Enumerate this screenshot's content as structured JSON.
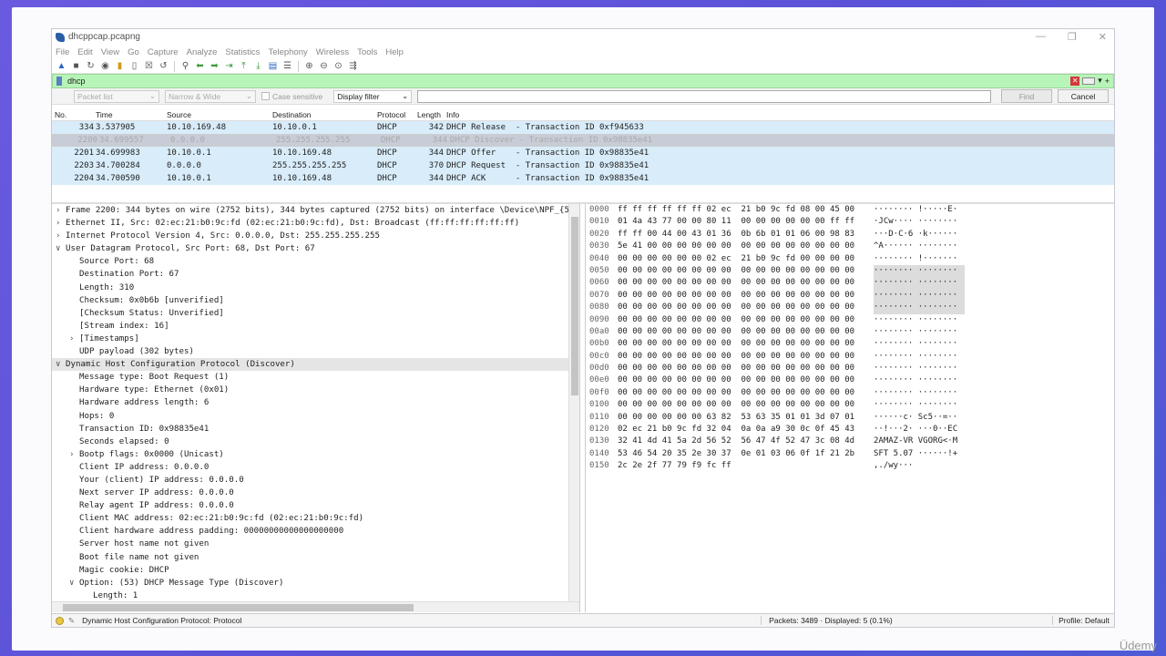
{
  "window": {
    "title": "dhcppcap.pcapng"
  },
  "menu": [
    "File",
    "Edit",
    "View",
    "Go",
    "Capture",
    "Analyze",
    "Statistics",
    "Telephony",
    "Wireless",
    "Tools",
    "Help"
  ],
  "filter": {
    "value": "dhcp"
  },
  "find": {
    "packet_list_select": "Packet list",
    "charset_select": "Narrow & Wide",
    "case_sensitive_label": "Case sensitive",
    "type_select": "Display filter",
    "find_button": "Find",
    "cancel_button": "Cancel"
  },
  "packet_list": {
    "headers": [
      "No.",
      "Time",
      "Source",
      "Destination",
      "Protocol",
      "Length",
      "Info"
    ],
    "rows": [
      {
        "no": "334",
        "time": "3.537905",
        "src": "10.10.169.48",
        "dst": "10.10.0.1",
        "proto": "DHCP",
        "len": "342",
        "info": "DHCP Release  - Transaction ID 0xf945633"
      },
      {
        "no": "2200",
        "time": "34.699557",
        "src": "0.0.0.0",
        "dst": "255.255.255.255",
        "proto": "DHCP",
        "len": "344",
        "info": "DHCP Discover - Transaction ID 0x98835e41"
      },
      {
        "no": "2201",
        "time": "34.699983",
        "src": "10.10.0.1",
        "dst": "10.10.169.48",
        "proto": "DHCP",
        "len": "344",
        "info": "DHCP Offer    - Transaction ID 0x98835e41"
      },
      {
        "no": "2203",
        "time": "34.700284",
        "src": "0.0.0.0",
        "dst": "255.255.255.255",
        "proto": "DHCP",
        "len": "370",
        "info": "DHCP Request  - Transaction ID 0x98835e41"
      },
      {
        "no": "2204",
        "time": "34.700590",
        "src": "10.10.0.1",
        "dst": "10.10.169.48",
        "proto": "DHCP",
        "len": "344",
        "info": "DHCP ACK      - Transaction ID 0x98835e41"
      }
    ]
  },
  "details": [
    {
      "indent": 0,
      "arrow": ">",
      "text": "Frame 2200: 344 bytes on wire (2752 bits), 344 bytes captured (2752 bits) on interface \\Device\\NPF_{5"
    },
    {
      "indent": 0,
      "arrow": ">",
      "text": "Ethernet II, Src: 02:ec:21:b0:9c:fd (02:ec:21:b0:9c:fd), Dst: Broadcast (ff:ff:ff:ff:ff:ff)"
    },
    {
      "indent": 0,
      "arrow": ">",
      "text": "Internet Protocol Version 4, Src: 0.0.0.0, Dst: 255.255.255.255"
    },
    {
      "indent": 0,
      "arrow": "v",
      "text": "User Datagram Protocol, Src Port: 68, Dst Port: 67"
    },
    {
      "indent": 1,
      "arrow": "",
      "text": "Source Port: 68"
    },
    {
      "indent": 1,
      "arrow": "",
      "text": "Destination Port: 67"
    },
    {
      "indent": 1,
      "arrow": "",
      "text": "Length: 310"
    },
    {
      "indent": 1,
      "arrow": "",
      "text": "Checksum: 0x0b6b [unverified]"
    },
    {
      "indent": 1,
      "arrow": "",
      "text": "[Checksum Status: Unverified]"
    },
    {
      "indent": 1,
      "arrow": "",
      "text": "[Stream index: 16]"
    },
    {
      "indent": 1,
      "arrow": ">",
      "text": "[Timestamps]"
    },
    {
      "indent": 1,
      "arrow": "",
      "text": "UDP payload (302 bytes)"
    },
    {
      "indent": 0,
      "arrow": "v",
      "text": "Dynamic Host Configuration Protocol (Discover)",
      "hl": true
    },
    {
      "indent": 1,
      "arrow": "",
      "text": "Message type: Boot Request (1)"
    },
    {
      "indent": 1,
      "arrow": "",
      "text": "Hardware type: Ethernet (0x01)"
    },
    {
      "indent": 1,
      "arrow": "",
      "text": "Hardware address length: 6"
    },
    {
      "indent": 1,
      "arrow": "",
      "text": "Hops: 0"
    },
    {
      "indent": 1,
      "arrow": "",
      "text": "Transaction ID: 0x98835e41"
    },
    {
      "indent": 1,
      "arrow": "",
      "text": "Seconds elapsed: 0"
    },
    {
      "indent": 1,
      "arrow": ">",
      "text": "Bootp flags: 0x0000 (Unicast)"
    },
    {
      "indent": 1,
      "arrow": "",
      "text": "Client IP address: 0.0.0.0"
    },
    {
      "indent": 1,
      "arrow": "",
      "text": "Your (client) IP address: 0.0.0.0"
    },
    {
      "indent": 1,
      "arrow": "",
      "text": "Next server IP address: 0.0.0.0"
    },
    {
      "indent": 1,
      "arrow": "",
      "text": "Relay agent IP address: 0.0.0.0"
    },
    {
      "indent": 1,
      "arrow": "",
      "text": "Client MAC address: 02:ec:21:b0:9c:fd (02:ec:21:b0:9c:fd)"
    },
    {
      "indent": 1,
      "arrow": "",
      "text": "Client hardware address padding: 00000000000000000000"
    },
    {
      "indent": 1,
      "arrow": "",
      "text": "Server host name not given"
    },
    {
      "indent": 1,
      "arrow": "",
      "text": "Boot file name not given"
    },
    {
      "indent": 1,
      "arrow": "",
      "text": "Magic cookie: DHCP"
    },
    {
      "indent": 1,
      "arrow": "v",
      "text": "Option: (53) DHCP Message Type (Discover)"
    },
    {
      "indent": 2,
      "arrow": "",
      "text": "Length: 1"
    }
  ],
  "hex": [
    {
      "off": "0000",
      "bytes": "ff ff ff ff ff ff 02 ec  21 b0 9c fd 08 00 45 00",
      "ascii": "········ !·····E·",
      "g": false
    },
    {
      "off": "0010",
      "bytes": "01 4a 43 77 00 00 80 11  00 00 00 00 00 00 ff ff",
      "ascii": "·JCw···· ········",
      "g": false
    },
    {
      "off": "0020",
      "bytes": "ff ff 00 44 00 43 01 36  0b 6b 01 01 06 00 98 83",
      "ascii": "···D·C·6 ·k······",
      "g": false
    },
    {
      "off": "0030",
      "bytes": "5e 41 00 00 00 00 00 00  00 00 00 00 00 00 00 00",
      "ascii": "^A······ ········",
      "g": false
    },
    {
      "off": "0040",
      "bytes": "00 00 00 00 00 00 02 ec  21 b0 9c fd 00 00 00 00",
      "ascii": "········ !·······",
      "g": false
    },
    {
      "off": "0050",
      "bytes": "00 00 00 00 00 00 00 00  00 00 00 00 00 00 00 00",
      "ascii": "········ ········",
      "g": true
    },
    {
      "off": "0060",
      "bytes": "00 00 00 00 00 00 00 00  00 00 00 00 00 00 00 00",
      "ascii": "········ ········",
      "g": true
    },
    {
      "off": "0070",
      "bytes": "00 00 00 00 00 00 00 00  00 00 00 00 00 00 00 00",
      "ascii": "········ ········",
      "g": true
    },
    {
      "off": "0080",
      "bytes": "00 00 00 00 00 00 00 00  00 00 00 00 00 00 00 00",
      "ascii": "········ ········",
      "g": true
    },
    {
      "off": "0090",
      "bytes": "00 00 00 00 00 00 00 00  00 00 00 00 00 00 00 00",
      "ascii": "········ ········",
      "g": false
    },
    {
      "off": "00a0",
      "bytes": "00 00 00 00 00 00 00 00  00 00 00 00 00 00 00 00",
      "ascii": "········ ········",
      "g": false
    },
    {
      "off": "00b0",
      "bytes": "00 00 00 00 00 00 00 00  00 00 00 00 00 00 00 00",
      "ascii": "········ ········",
      "g": false
    },
    {
      "off": "00c0",
      "bytes": "00 00 00 00 00 00 00 00  00 00 00 00 00 00 00 00",
      "ascii": "········ ········",
      "g": false
    },
    {
      "off": "00d0",
      "bytes": "00 00 00 00 00 00 00 00  00 00 00 00 00 00 00 00",
      "ascii": "········ ········",
      "g": false
    },
    {
      "off": "00e0",
      "bytes": "00 00 00 00 00 00 00 00  00 00 00 00 00 00 00 00",
      "ascii": "········ ········",
      "g": false
    },
    {
      "off": "00f0",
      "bytes": "00 00 00 00 00 00 00 00  00 00 00 00 00 00 00 00",
      "ascii": "········ ········",
      "g": false
    },
    {
      "off": "0100",
      "bytes": "00 00 00 00 00 00 00 00  00 00 00 00 00 00 00 00",
      "ascii": "········ ········",
      "g": false
    },
    {
      "off": "0110",
      "bytes": "00 00 00 00 00 00 63 82  53 63 35 01 01 3d 07 01",
      "ascii": "······c· Sc5··=··",
      "g": false
    },
    {
      "off": "0120",
      "bytes": "02 ec 21 b0 9c fd 32 04  0a 0a a9 30 0c 0f 45 43",
      "ascii": "··!···2· ···0··EC",
      "g": false
    },
    {
      "off": "0130",
      "bytes": "32 41 4d 41 5a 2d 56 52  56 47 4f 52 47 3c 08 4d",
      "ascii": "2AMAZ-VR VGORG<·M",
      "g": false
    },
    {
      "off": "0140",
      "bytes": "53 46 54 20 35 2e 30 37  0e 01 03 06 0f 1f 21 2b",
      "ascii": "SFT 5.07 ······!+",
      "g": false
    },
    {
      "off": "0150",
      "bytes": "2c 2e 2f 77 79 f9 fc ff",
      "ascii": ",./wy···",
      "g": false
    }
  ],
  "status": {
    "left": "Dynamic Host Configuration Protocol: Protocol",
    "packets": "Packets: 3489 · Displayed: 5 (0.1%)",
    "profile": "Profile: Default"
  },
  "watermark": "Üdemy"
}
